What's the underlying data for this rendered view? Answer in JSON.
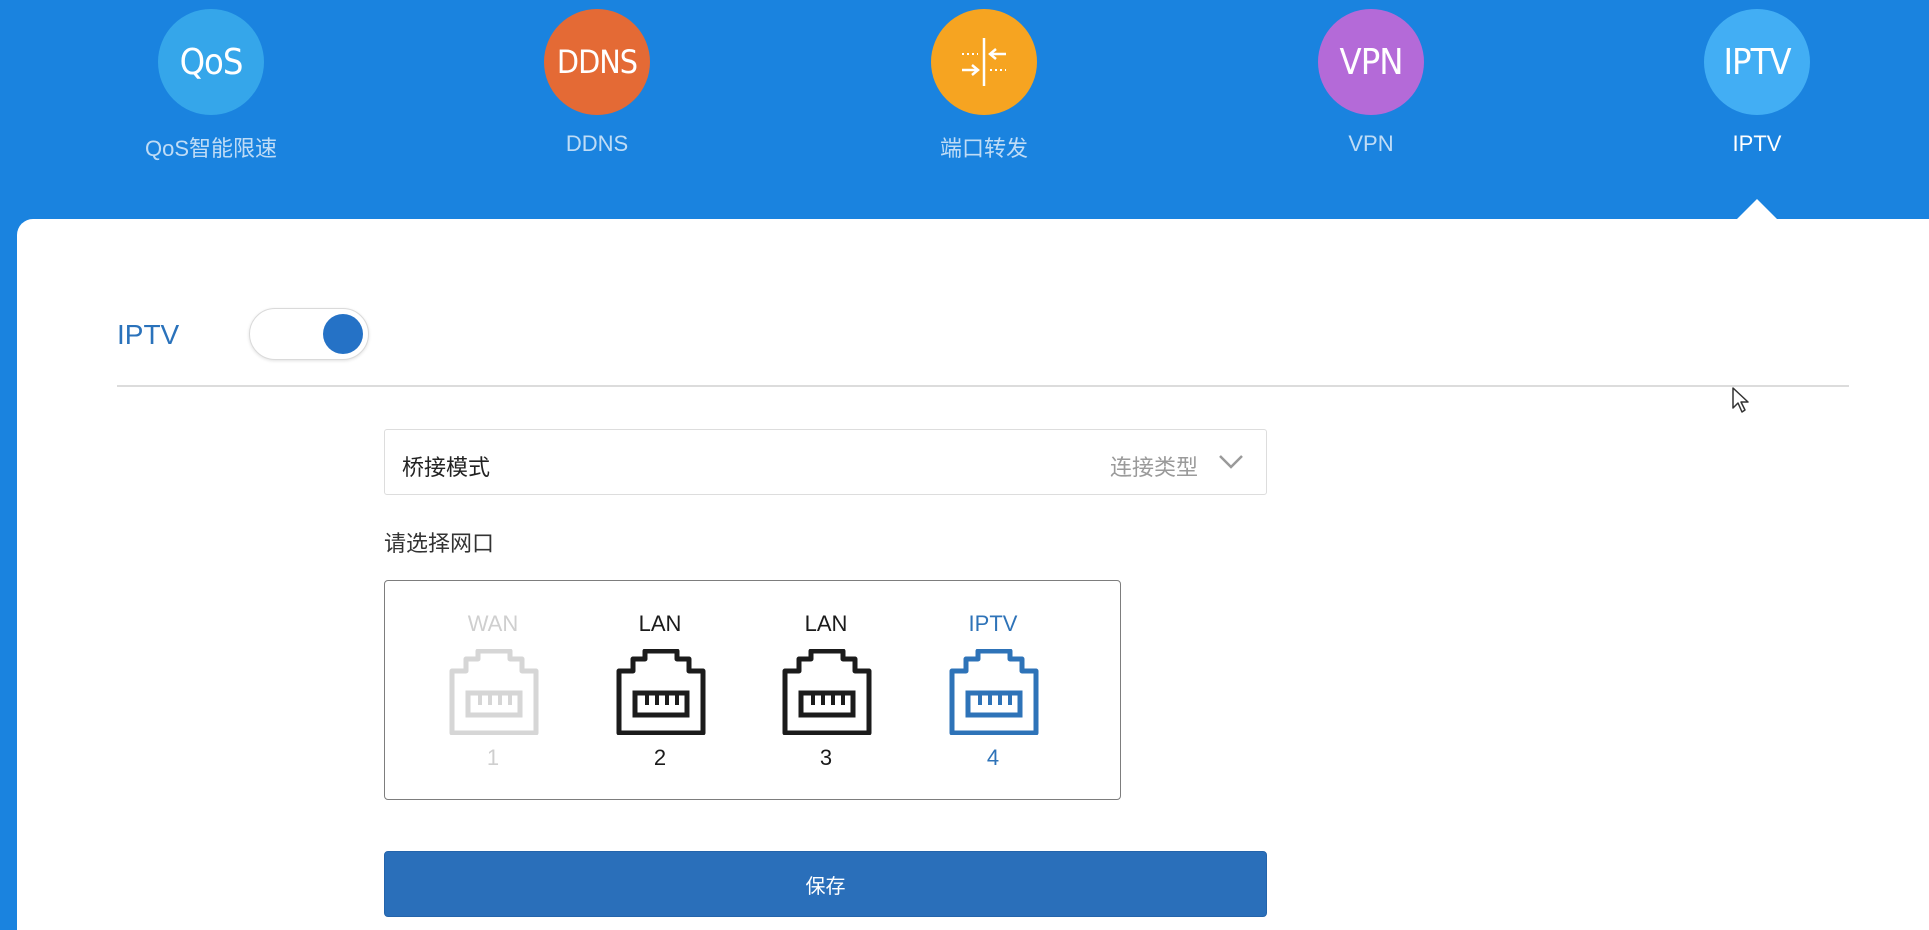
{
  "nav": {
    "items": [
      {
        "icon_text": "QoS",
        "label": "QoS智能限速",
        "color": "#35a6ea"
      },
      {
        "icon_text": "DDNS",
        "label": "DDNS",
        "color": "#e46a35"
      },
      {
        "icon_text": "",
        "icon": "port-forward-icon",
        "label": "端口转发",
        "color": "#f6a421"
      },
      {
        "icon_text": "VPN",
        "label": "VPN",
        "color": "#b46ad8"
      },
      {
        "icon_text": "IPTV",
        "label": "IPTV",
        "color": "#42aef4"
      }
    ],
    "active": "IPTV"
  },
  "iptv": {
    "label": "IPTV",
    "enabled": true
  },
  "connection": {
    "value": "桥接模式",
    "hint": "连接类型"
  },
  "ports": {
    "prompt": "请选择网口",
    "items": [
      {
        "type": "WAN",
        "number": "1",
        "state": "disabled"
      },
      {
        "type": "LAN",
        "number": "2",
        "state": "normal"
      },
      {
        "type": "LAN",
        "number": "3",
        "state": "normal"
      },
      {
        "type": "IPTV",
        "number": "4",
        "state": "selected"
      }
    ]
  },
  "actions": {
    "save_label": "保存"
  },
  "colors": {
    "header_bg": "#1a83df",
    "accent": "#2a6fba",
    "selected_port": "#2e73b8"
  }
}
